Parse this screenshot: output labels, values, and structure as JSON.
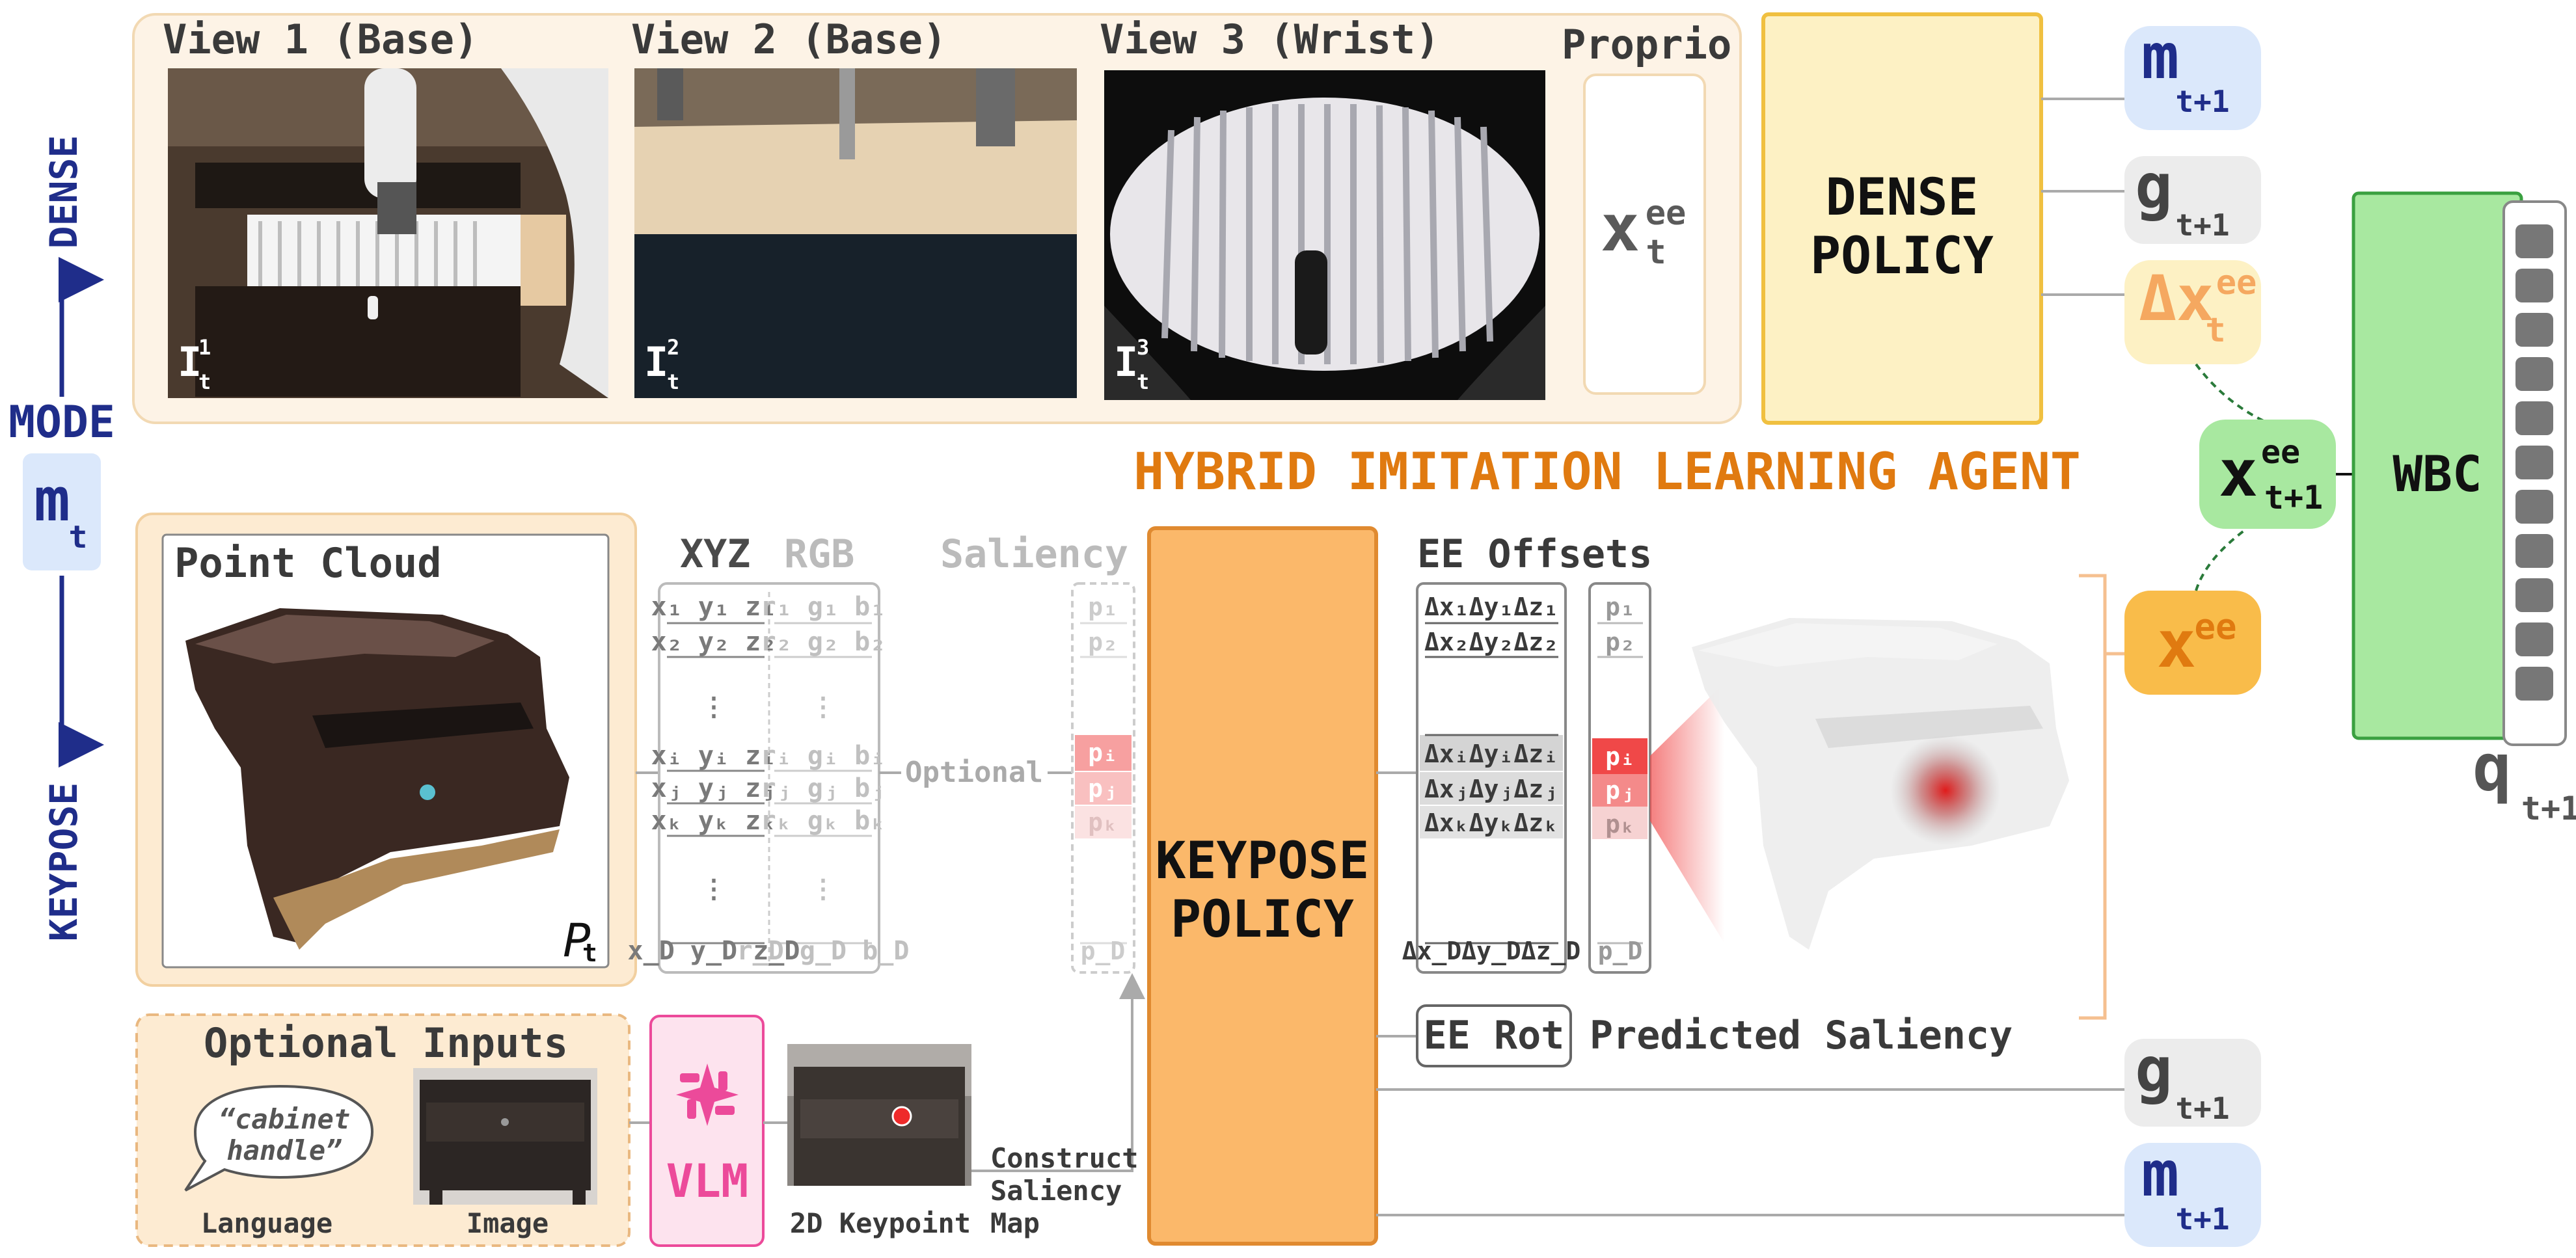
{
  "title": "HYBRID IMITATION LEARNING AGENT",
  "mode": {
    "label": "MODE",
    "dense": "DENSE",
    "keypose": "KEYPOSE",
    "symbol": "m",
    "sub": "t"
  },
  "dense_inputs": {
    "views": [
      {
        "label": "View 1 (Base)",
        "img_symbol": "I",
        "sup": "1",
        "sub": "t"
      },
      {
        "label": "View 2 (Base)",
        "img_symbol": "I",
        "sup": "2",
        "sub": "t"
      },
      {
        "label": "View 3 (Wrist)",
        "img_symbol": "I",
        "sup": "3",
        "sub": "t"
      }
    ],
    "proprio_label": "Proprio",
    "proprio_symbol": "x",
    "proprio_sup": "ee",
    "proprio_sub": "t"
  },
  "dense_policy": {
    "line1": "DENSE",
    "line2": "POLICY"
  },
  "dense_outputs": [
    {
      "symbol": "m",
      "sup": "",
      "sub": "t+1"
    },
    {
      "symbol": "g",
      "sup": "",
      "sub": "t+1"
    },
    {
      "symbol": "Δx",
      "sup": "ee",
      "sub": "t"
    }
  ],
  "pointcloud": {
    "label": "Point Cloud",
    "symbol": "P",
    "sub": "t"
  },
  "table_headers": {
    "xyz": "XYZ",
    "rgb": "RGB",
    "saliency": "Saliency",
    "ee_offsets": "EE Offsets"
  },
  "xyz_rows": [
    [
      "x₁",
      "y₁",
      "z₁"
    ],
    [
      "x₂",
      "y₂",
      "z₂"
    ],
    [
      "⋮",
      "",
      ""
    ],
    [
      "xᵢ",
      "yᵢ",
      "zᵢ"
    ],
    [
      "xⱼ",
      "yⱼ",
      "zⱼ"
    ],
    [
      "xₖ",
      "yₖ",
      "zₖ"
    ],
    [
      "⋮",
      "",
      ""
    ],
    [
      "x_D",
      "y_D",
      "z_D"
    ]
  ],
  "xyz_rows_text": [
    "x₁ y₁ z₁",
    "x₂ y₂ z₂",
    "⋮",
    "xᵢ yᵢ zᵢ",
    "xⱼ yⱼ zⱼ",
    "xₖ yₖ zₖ",
    "⋮",
    "x_D y_D z_D"
  ],
  "rgb_rows_text": [
    "r₁ g₁ b₁",
    "r₂ g₂ b₂",
    "⋮",
    "rᵢ gᵢ bᵢ",
    "rⱼ gⱼ bⱼ",
    "rₖ gₖ bₖ",
    "⋮",
    "r_D g_D b_D"
  ],
  "saliency_rows_text": [
    "p₁",
    "p₂",
    "pᵢ",
    "pⱼ",
    "pₖ",
    "p_D"
  ],
  "offset_rows_text": [
    "Δx₁Δy₁Δz₁",
    "Δx₂Δy₂Δz₂",
    "ΔxᵢΔyᵢΔzᵢ",
    "ΔxⱼΔyⱼΔzⱼ",
    "ΔxₖΔyₖΔzₖ",
    "Δx_DΔy_DΔz_D"
  ],
  "optional_label": "Optional",
  "keypose_policy": {
    "line1": "KEYPOSE",
    "line2": "POLICY"
  },
  "ee_rot": "EE Rot",
  "predicted_saliency": "Predicted Saliency",
  "optional_inputs": {
    "label": "Optional Inputs",
    "language_text_1": "“cabinet",
    "language_text_2": "handle”",
    "language_label": "Language",
    "image_label": "Image",
    "vlm_label": "VLM",
    "keypoint_label": "2D Keypoint",
    "construct_1": "Construct",
    "construct_2": "Saliency",
    "construct_3": "Map"
  },
  "keypose_outputs": [
    {
      "symbol": "g",
      "sub": "t+1"
    },
    {
      "symbol": "m",
      "sub": "t+1"
    }
  ],
  "x_ee": {
    "symbol": "x",
    "sup": "ee"
  },
  "x_next": {
    "symbol": "x",
    "sup": "ee",
    "sub": "t+1"
  },
  "wbc": "WBC",
  "q_out": {
    "symbol": "q",
    "sub": "t+1"
  },
  "colors": {
    "navy": "#1f2d8a",
    "orange_title": "#e07a10",
    "dense_policy_fill": "#fdf1c4",
    "dense_policy_stroke": "#f0c040",
    "keypose_fill": "#fbb86a",
    "keypose_stroke": "#e08a30",
    "wbc_fill": "#a8e8a0",
    "wbc_stroke": "#3aa040",
    "blue_pill": "#dbe8fb",
    "grey_pill": "#ececec",
    "saliency_red": "#f04848"
  }
}
